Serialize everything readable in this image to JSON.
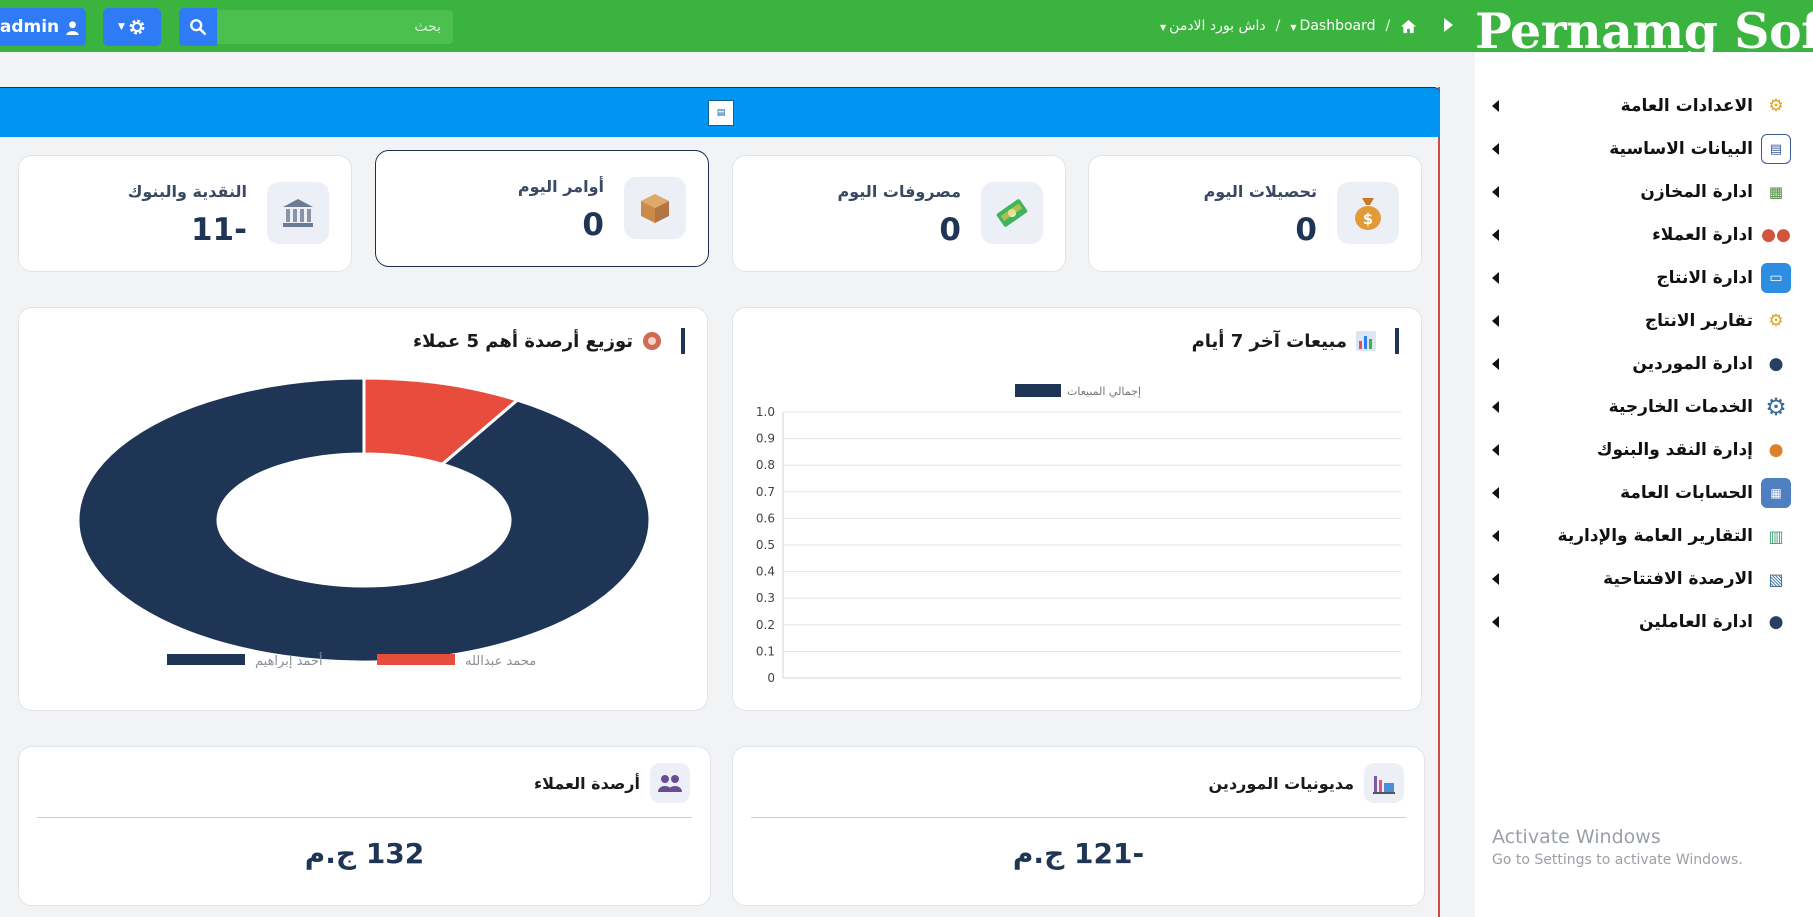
{
  "header": {
    "admin_label": "admin",
    "search_placeholder": "بحث",
    "breadcrumb": {
      "root": "داش بورد الادمن",
      "current": "Dashboard",
      "separator": "/"
    },
    "logo": "Pernamg Soft"
  },
  "sidebar": {
    "items": [
      {
        "label": "الاعدادات العامة",
        "icon": "gear-icon"
      },
      {
        "label": "البيانات الاساسية",
        "icon": "document-icon"
      },
      {
        "label": "ادارة المخازن",
        "icon": "clipboard-icon"
      },
      {
        "label": "ادارة العملاء",
        "icon": "users-icon"
      },
      {
        "label": "ادارة الانتاج",
        "icon": "printer-icon"
      },
      {
        "label": "تقارير الانتاج",
        "icon": "gear-icon"
      },
      {
        "label": "ادارة الموردين",
        "icon": "person-icon"
      },
      {
        "label": "الخدمات الخارجية",
        "icon": "cog-icon"
      },
      {
        "label": "إدارة النقد والبنوك",
        "icon": "money-bag-icon"
      },
      {
        "label": "الحسابات العامة",
        "icon": "calculator-icon"
      },
      {
        "label": "التقارير العامة والإدارية",
        "icon": "chart-icon"
      },
      {
        "label": "الارصدة الافتتاحية",
        "icon": "report-icon"
      },
      {
        "label": "ادارة العاملين",
        "icon": "person-icon"
      }
    ]
  },
  "stats": [
    {
      "title": "تحصيلات اليوم",
      "value": "0",
      "icon": "money-bag-icon"
    },
    {
      "title": "مصروفات اليوم",
      "value": "0",
      "icon": "cash-icon"
    },
    {
      "title": "أوامر اليوم",
      "value": "0",
      "icon": "box-icon"
    },
    {
      "title": "النقدية والبنوك",
      "value": "-11",
      "icon": "bank-icon"
    }
  ],
  "sales_panel": {
    "title": "مبيعات آخر 7 أيام",
    "icon": "bar-chart-icon"
  },
  "balance_panel": {
    "title": "توزيع أرصدة أهم 5 عملاء",
    "icon": "donut-icon"
  },
  "chart_data": [
    {
      "type": "line",
      "series": [
        {
          "name": "إجمالي المبيعات",
          "values": []
        }
      ],
      "x": [],
      "ylim": [
        0,
        1.0
      ],
      "yticks": [
        "0",
        "0.1",
        "0.2",
        "0.3",
        "0.4",
        "0.5",
        "0.6",
        "0.7",
        "0.8",
        "0.9",
        "1.0"
      ],
      "grid": true,
      "legend": "top"
    },
    {
      "type": "pie",
      "donut": true,
      "categories": [
        "أحمد إبراهيم",
        "محمد عبدالله"
      ],
      "values": [
        91,
        9
      ],
      "colors": [
        "#1f3556",
        "#e74c3c"
      ],
      "legend": "bottom"
    }
  ],
  "bottom_cards": [
    {
      "title": "مديونيات الموردين",
      "value": "-121 ج.م",
      "icon": "factory-icon"
    },
    {
      "title": "أرصدة العملاء",
      "value": "132 ج.م",
      "icon": "users-icon"
    }
  ],
  "windows_notice": {
    "line1": "Activate Windows",
    "line2": "Go to Settings to activate Windows."
  }
}
